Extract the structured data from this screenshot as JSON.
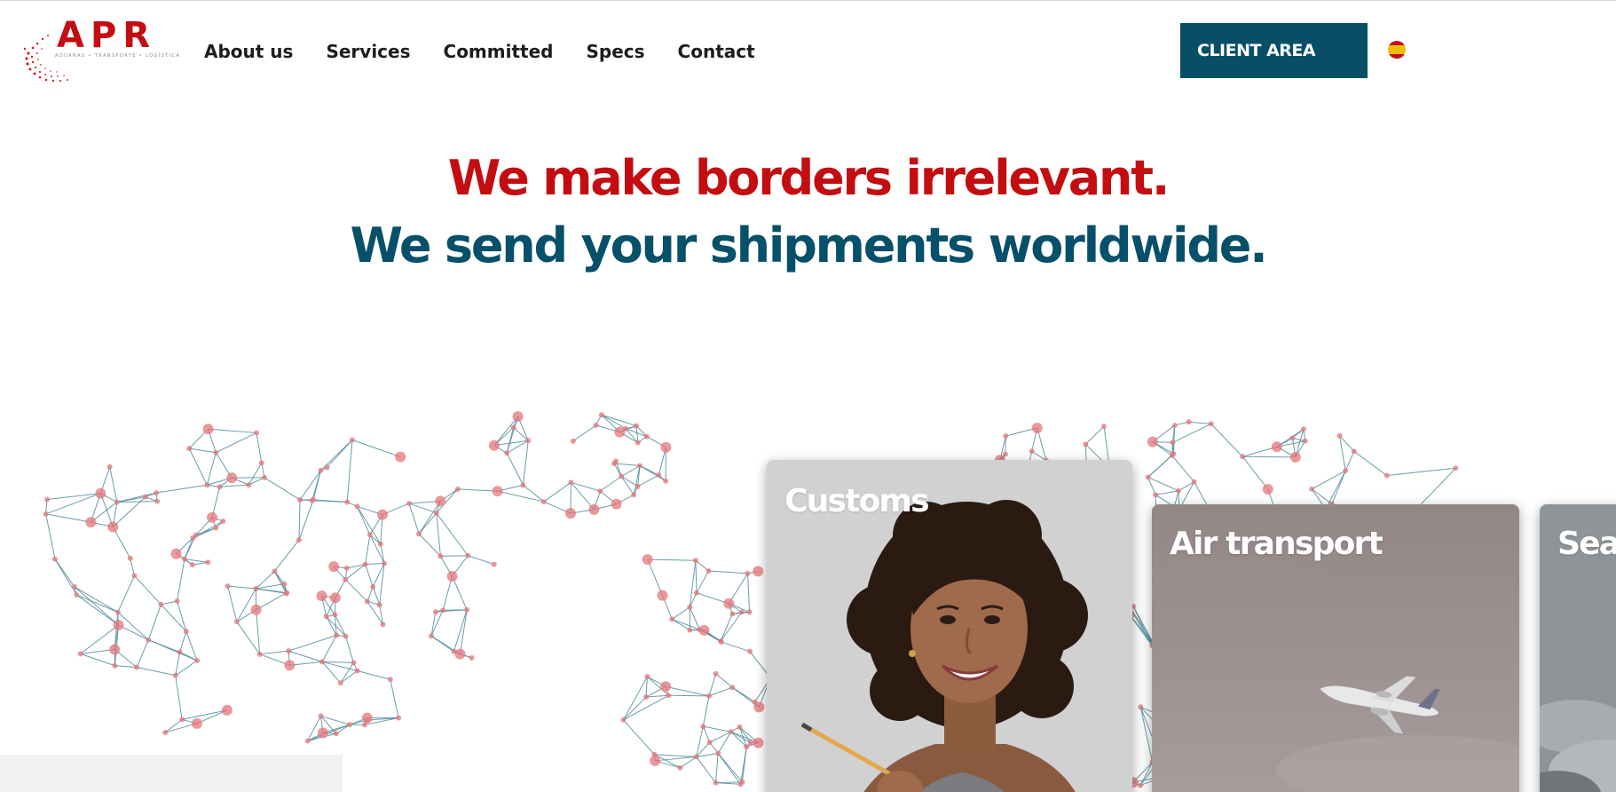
{
  "header": {
    "logo_text": "APR",
    "logo_subtext": "ADUANAS • TRANSPORTE • LOGÍSTICA",
    "nav": [
      {
        "label": "About us"
      },
      {
        "label": "Services"
      },
      {
        "label": "Committed"
      },
      {
        "label": "Specs"
      },
      {
        "label": "Contact"
      }
    ],
    "client_area_label": "CLIENT AREA",
    "language_flag": "spain-flag-icon"
  },
  "hero": {
    "line1": "We make borders irrelevant.",
    "line2": "We send your shipments worldwide."
  },
  "services": [
    {
      "title": "Customs"
    },
    {
      "title": "Air transport"
    },
    {
      "title": "Sea"
    }
  ],
  "colors": {
    "brand_red": "#c30d10",
    "brand_teal": "#06506a",
    "button_bg": "#074e66",
    "network_line": "#4e8c9c",
    "network_node": "#e5767a"
  }
}
